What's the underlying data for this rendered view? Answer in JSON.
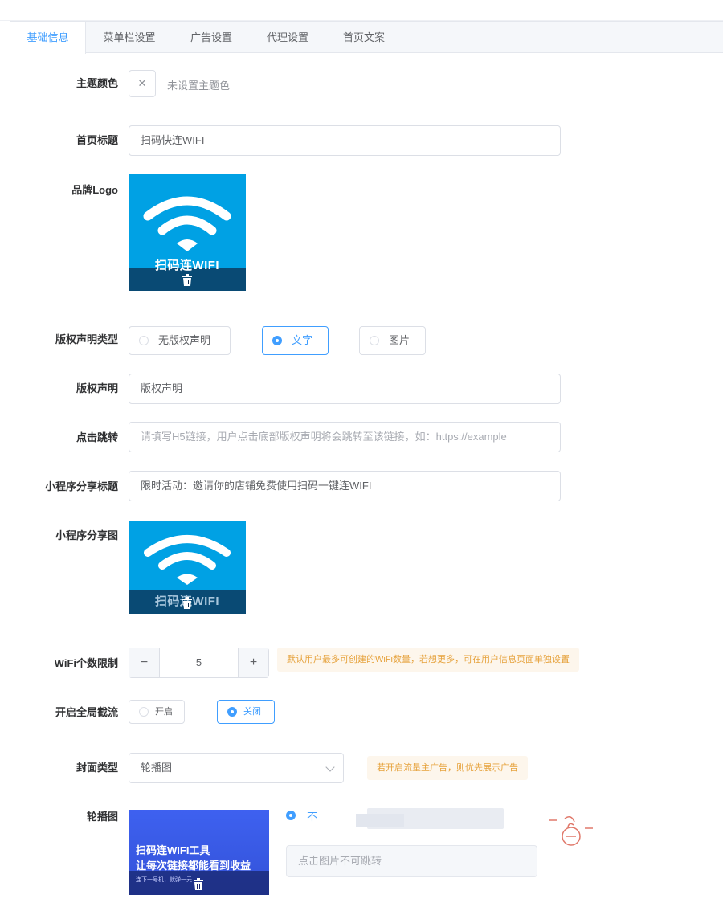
{
  "tabs": [
    {
      "label": "基础信息",
      "active": true
    },
    {
      "label": "菜单栏设置",
      "active": false
    },
    {
      "label": "广告设置",
      "active": false
    },
    {
      "label": "代理设置",
      "active": false
    },
    {
      "label": "首页文案",
      "active": false
    }
  ],
  "form": {
    "theme_color": {
      "label": "主题颜色",
      "value_text": "未设置主题色",
      "clear_icon": "close-icon"
    },
    "home_title": {
      "label": "首页标题",
      "value": "扫码快连WIFI"
    },
    "brand_logo": {
      "label": "品牌Logo",
      "image_text": "扫码连WIFI",
      "image_bg": "#00a1e4",
      "icon": "wifi-icon"
    },
    "copyright_type": {
      "label": "版权声明类型",
      "options": [
        {
          "label": "无版权声明",
          "selected": false
        },
        {
          "label": "文字",
          "selected": true
        },
        {
          "label": "图片",
          "selected": false
        }
      ]
    },
    "copyright": {
      "label": "版权声明",
      "value": "版权声明"
    },
    "click_jump": {
      "label": "点击跳转",
      "placeholder": "请填写H5链接，用户点击底部版权声明将会跳转至该链接，如：https://example"
    },
    "share_title": {
      "label": "小程序分享标题",
      "value": "限时活动：邀请你的店铺免费使用扫码一键连WIFI"
    },
    "share_image": {
      "label": "小程序分享图",
      "image_text": "扫码连WIFI",
      "image_bg": "#00a1e4"
    },
    "wifi_limit": {
      "label": "WiFi个数限制",
      "value": "5",
      "decrement": "−",
      "increment": "+",
      "tip": "默认用户最多可创建的WiFi数量，若想更多，可在用户信息页面单独设置"
    },
    "global_throttle": {
      "label": "开启全局截流",
      "options": [
        {
          "label": "开启",
          "selected": false
        },
        {
          "label": "关闭",
          "selected": true
        }
      ]
    },
    "cover_type": {
      "label": "封面类型",
      "value": "轮播图",
      "tip": "若开启流量主广告，则优先展示广告"
    },
    "carousel": {
      "label": "轮播图",
      "line1": "扫码连WIFI工具",
      "line2": "让每次链接都能看到收益",
      "small_text": "连下一号机，就弹一元",
      "jump_option": "不",
      "jump_placeholder": "点击图片不可跳转"
    }
  },
  "colors": {
    "accent": "#409eff",
    "tip_bg": "#fdf6ec",
    "tip_text": "#e6a23c",
    "paste_icon": "#e0786a"
  }
}
